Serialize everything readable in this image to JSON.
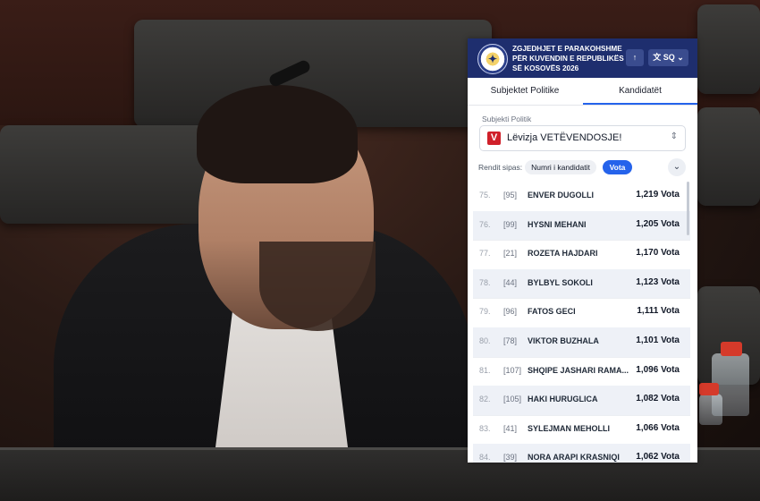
{
  "header": {
    "title": "ZGJEDHJET E PARAKOHSHME PËR KUVENDIN E REPUBLIKËS SË KOSOVËS 2026",
    "up_icon": "arrow-up-icon",
    "lang_label": "SQ",
    "lang_icon": "translate-icon"
  },
  "tabs": [
    {
      "label": "Subjektet Politike",
      "active": false
    },
    {
      "label": "Kandidatët",
      "active": true
    }
  ],
  "filter": {
    "label": "Subjekti Politik",
    "party_mark": "V",
    "party_name": "Lëvizja VETËVENDOSJE!",
    "party_color": "#d0202a"
  },
  "sort": {
    "label": "Rendit sipas:",
    "options": [
      {
        "label": "Numri i kandidatit",
        "active": false
      },
      {
        "label": "Vota",
        "active": true
      }
    ]
  },
  "candidates": [
    {
      "rank": "75.",
      "number": "[95]",
      "name": "ENVER DUGOLLI",
      "votes": "1,219 Vota"
    },
    {
      "rank": "76.",
      "number": "[99]",
      "name": "HYSNI MEHANI",
      "votes": "1,205 Vota"
    },
    {
      "rank": "77.",
      "number": "[21]",
      "name": "ROZETA HAJDARI",
      "votes": "1,170 Vota"
    },
    {
      "rank": "78.",
      "number": "[44]",
      "name": "BYLBYL SOKOLI",
      "votes": "1,123 Vota"
    },
    {
      "rank": "79.",
      "number": "[96]",
      "name": "FATOS GECI",
      "votes": "1,111 Vota"
    },
    {
      "rank": "80.",
      "number": "[78]",
      "name": "VIKTOR BUZHALA",
      "votes": "1,101 Vota"
    },
    {
      "rank": "81.",
      "number": "[107]",
      "name": "SHQIPE JASHARI RAMA...",
      "votes": "1,096 Vota"
    },
    {
      "rank": "82.",
      "number": "[105]",
      "name": "HAKI HURUGLICA",
      "votes": "1,082 Vota"
    },
    {
      "rank": "83.",
      "number": "[41]",
      "name": "SYLEJMAN MEHOLLI",
      "votes": "1,066 Vota"
    },
    {
      "rank": "84.",
      "number": "[39]",
      "name": "NORA ARAPI KRASNIQI",
      "votes": "1,062 Vota"
    }
  ]
}
